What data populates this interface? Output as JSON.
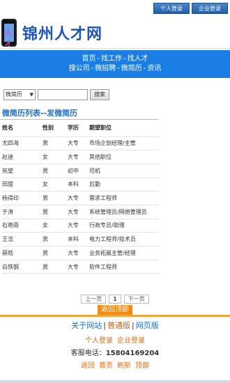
{
  "topbar": {
    "personal_login": "个人登录",
    "company_login": "企业登录"
  },
  "site": {
    "title": "锦州人才网",
    "logo_mark": "人才"
  },
  "nav": {
    "row1": [
      "首页",
      "找工作",
      "找人才"
    ],
    "row2": [
      "搜公司",
      "微招聘",
      "微简历",
      "资讯"
    ]
  },
  "search": {
    "select_value": "微简历",
    "button": "搜索",
    "placeholder": ""
  },
  "list": {
    "title_main": "微简历列表",
    "title_sep": "--",
    "title_sub": "发微简历",
    "headers": [
      "姓名",
      "性别",
      "学历",
      "期望职位"
    ],
    "rows": [
      [
        "尤四海",
        "男",
        "大专",
        "市场企划经理/主管"
      ],
      [
        "赵迪",
        "女",
        "大专",
        "其他职位"
      ],
      [
        "苑望",
        "男",
        "初中",
        "司机"
      ],
      [
        "田甜",
        "女",
        "本科",
        "后勤"
      ],
      [
        "杨得印",
        "男",
        "大专",
        "需求工程师"
      ],
      [
        "于涛",
        "男",
        "大专",
        "系统管理员/网络管理员"
      ],
      [
        "石艳雨",
        "女",
        "大专",
        "行政专员/助理"
      ],
      [
        "王浩",
        "男",
        "本科",
        "电力工程师/技术员"
      ],
      [
        "蔡皓",
        "男",
        "大专",
        "业务拓展主管/经理"
      ],
      [
        "白铁钢",
        "男",
        "大专",
        "软件工程师"
      ]
    ]
  },
  "pager": {
    "prev": "上一页",
    "current": "1",
    "next": "下一页"
  },
  "back_top": "返回顶部",
  "footer": {
    "about": "关于网站",
    "normal": "普通版",
    "web": "网页版",
    "personal_login": "个人登录",
    "company_login": "企业登录",
    "phone_label": "客服电话：",
    "phone": "15804169204",
    "links": [
      "返回",
      "首页",
      "刷新",
      "顶部"
    ]
  }
}
